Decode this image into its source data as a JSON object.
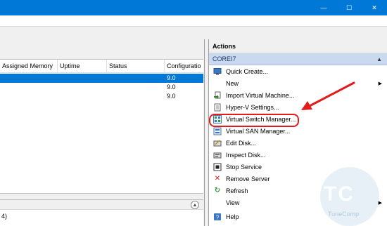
{
  "window": {
    "controls": {
      "minimize": "—",
      "maximize": "☐",
      "close": "✕"
    }
  },
  "grid": {
    "columns": [
      "Assigned Memory",
      "Uptime",
      "Status",
      "Configuratio"
    ],
    "rows": [
      {
        "config": "9.0",
        "selected": true
      },
      {
        "config": "9.0",
        "selected": false
      },
      {
        "config": "9.0",
        "selected": false
      }
    ]
  },
  "lower": {
    "fragment": "4)"
  },
  "actions": {
    "title": "Actions",
    "group": "COREI7",
    "items": [
      {
        "label": "Quick Create...",
        "icon": "monitor-icon"
      },
      {
        "label": "New",
        "icon": "blank",
        "submenu": true
      },
      {
        "label": "Import Virtual Machine...",
        "icon": "import-icon"
      },
      {
        "label": "Hyper-V Settings...",
        "icon": "document-icon"
      },
      {
        "label": "Virtual Switch Manager...",
        "icon": "switch-icon"
      },
      {
        "label": "Virtual SAN Manager...",
        "icon": "san-icon"
      },
      {
        "label": "Edit Disk...",
        "icon": "edit-disk-icon"
      },
      {
        "label": "Inspect Disk...",
        "icon": "inspect-disk-icon"
      },
      {
        "label": "Stop Service",
        "icon": "stop-icon"
      },
      {
        "label": "Remove Server",
        "icon": "remove-icon"
      },
      {
        "label": "Refresh",
        "icon": "refresh-icon"
      },
      {
        "label": "View",
        "icon": "blank",
        "submenu": true
      },
      {
        "label": "Help",
        "icon": "help-icon"
      }
    ]
  },
  "watermark": {
    "text": "TC",
    "sub": "TuneComp"
  },
  "colors": {
    "titlebar": "#0078d7",
    "selected_row": "#0078d7",
    "highlight": "#e21b1b",
    "group_header": "#c9daf0"
  }
}
